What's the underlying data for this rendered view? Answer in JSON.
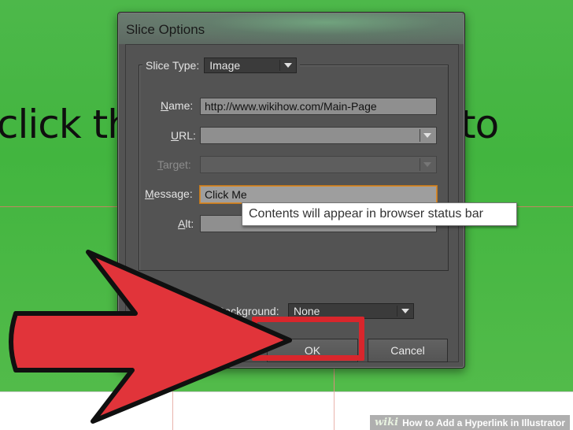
{
  "canvas": {
    "text_left": "click th",
    "text_right": "to"
  },
  "dialog": {
    "title": "Slice Options",
    "slice_type": {
      "label": "Slice Type:",
      "value": "Image"
    },
    "fields": {
      "name": {
        "label_underlined": "N",
        "label_rest": "ame:",
        "value": "http://www.wikihow.com/Main-Page"
      },
      "url": {
        "label_underlined": "U",
        "label_rest": "RL:",
        "value": ""
      },
      "target": {
        "label_underlined": "T",
        "label_rest": "arget:",
        "value": ""
      },
      "message": {
        "label_underlined": "M",
        "label_rest": "essage:",
        "value": "Click Me"
      },
      "alt": {
        "label_underlined": "A",
        "label_rest": "lt:",
        "value": ""
      }
    },
    "tooltip": "Contents will appear in browser status bar",
    "background": {
      "label": "Background:",
      "value": "None"
    },
    "buttons": {
      "ok": "OK",
      "cancel": "Cancel"
    }
  },
  "watermark": {
    "logo": "wiki",
    "text": "How to Add a Hyperlink in Illustrator"
  },
  "colors": {
    "artboard_green": "#4db84a",
    "highlight_red": "#d9262c",
    "active_border": "#d68a2e"
  }
}
